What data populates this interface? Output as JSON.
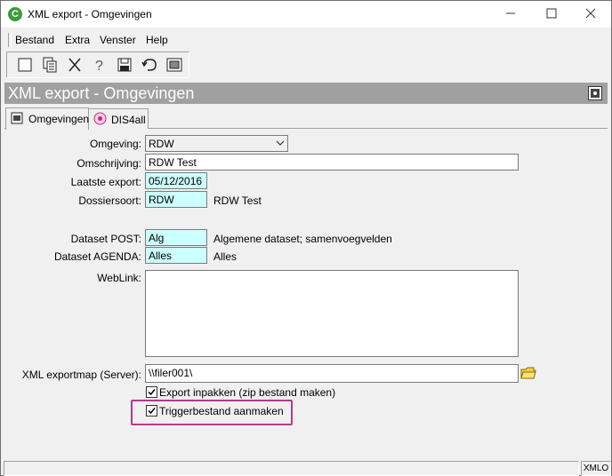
{
  "window": {
    "title": "XML export - Omgevingen",
    "app_icon": "C",
    "controls": [
      "minimize-icon",
      "maximize-icon",
      "close-icon"
    ]
  },
  "menu": {
    "items": [
      "Bestand",
      "Extra",
      "Venster",
      "Help"
    ]
  },
  "toolbar": {
    "tools": [
      "new-icon",
      "copy-icon",
      "delete-icon",
      "help-icon",
      "save-icon",
      "undo-icon",
      "export-icon"
    ]
  },
  "banner": {
    "title": "XML export - Omgevingen"
  },
  "tabs": [
    {
      "label": "Omgevingen",
      "icon": "environment-icon",
      "active": true
    },
    {
      "label": "DIS4all",
      "icon": "dis4all-icon",
      "active": false
    }
  ],
  "form": {
    "omgeving": {
      "label": "Omgeving:",
      "value": "RDW"
    },
    "omschrijving": {
      "label": "Omschrijving:",
      "value": "RDW Test"
    },
    "laatste_export": {
      "label": "Laatste export:",
      "value": "05/12/2016"
    },
    "dossiersoort": {
      "label": "Dossiersoort:",
      "value": "RDW",
      "description": "RDW Test"
    },
    "dataset_post": {
      "label": "Dataset POST:",
      "value": "Alg",
      "description": "Algemene dataset; samenvoegvelden"
    },
    "dataset_agenda": {
      "label": "Dataset AGENDA:",
      "value": "Alles",
      "description": "Alles"
    },
    "weblink": {
      "label": "WebLink:",
      "value": ""
    },
    "exportmap": {
      "label": "XML exportmap (Server):",
      "value": "\\\\filer001\\"
    },
    "export_inpakken": {
      "label": "Export inpakken (zip bestand maken)",
      "checked": true
    },
    "triggerbestand": {
      "label": "Triggerbestand aanmaken",
      "checked": true
    }
  },
  "statusbar": {
    "right": "XMLO"
  }
}
